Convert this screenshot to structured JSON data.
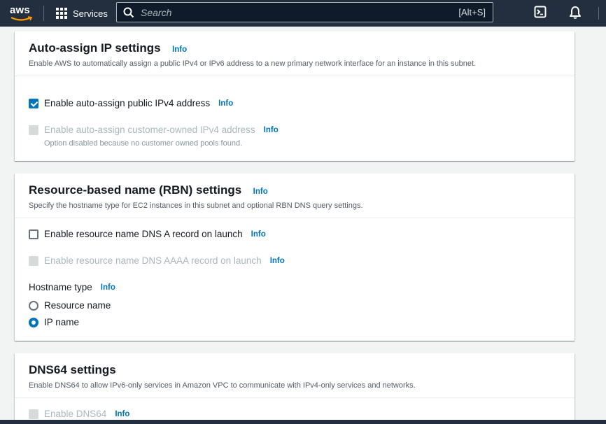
{
  "nav": {
    "logo_text": "aws",
    "services_label": "Services",
    "search_placeholder": "Search",
    "search_shortcut": "[Alt+S]",
    "icons": [
      "services-grid-icon",
      "search-icon",
      "cloudshell-icon",
      "notifications-bell-icon"
    ]
  },
  "auto_assign": {
    "title": "Auto-assign IP settings",
    "info": "Info",
    "description": "Enable AWS to automatically assign a public IPv4 or IPv6 address to a new primary network interface for an instance in this subnet.",
    "ipv4_label": "Enable auto-assign public IPv4 address",
    "ipv4_checked": true,
    "ipv4_info": "Info",
    "customer_owned_label": "Enable auto-assign customer-owned IPv4 address",
    "customer_owned_info": "Info",
    "customer_owned_hint": "Option disabled because no customer owned pools found."
  },
  "rbn": {
    "title": "Resource-based name (RBN) settings",
    "info": "Info",
    "description": "Specify the hostname type for EC2 instances in this subnet and optional RBN DNS query settings.",
    "dns_a_label": "Enable resource name DNS A record on launch",
    "dns_a_checked": false,
    "dns_a_info": "Info",
    "dns_aaaa_label": "Enable resource name DNS AAAA record on launch",
    "dns_aaaa_info": "Info",
    "hostname_type_label": "Hostname type",
    "hostname_type_info": "Info",
    "options": [
      "Resource name",
      "IP name"
    ],
    "selected_option": "IP name"
  },
  "dns64": {
    "title": "DNS64 settings",
    "description": "Enable DNS64 to allow IPv6-only services in Amazon VPC to communicate with IPv4-only services and networks.",
    "enable_label": "Enable DNS64",
    "enable_info": "Info"
  },
  "colors": {
    "nav_bg": "#232f3e",
    "link": "#0073bb",
    "checked": "#0073bb",
    "disabled_text": "#aab7b8"
  }
}
